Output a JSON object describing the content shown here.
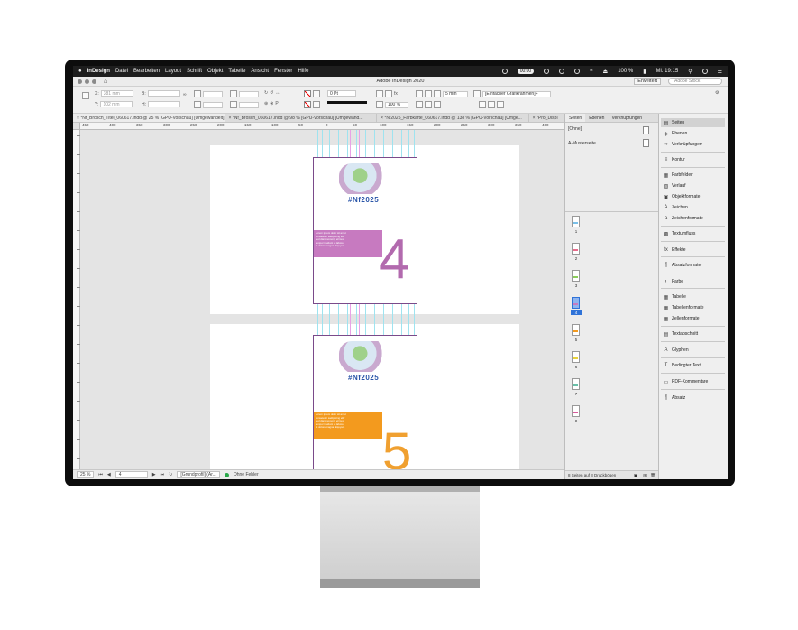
{
  "menubar": {
    "apple": "",
    "app": "InDesign",
    "items": [
      "Datei",
      "Bearbeiten",
      "Layout",
      "Schrift",
      "Objekt",
      "Tabelle",
      "Ansicht",
      "Fenster",
      "Hilfe"
    ],
    "timer": "00:00",
    "battery": "100 %",
    "clock": "Mi. 19:15"
  },
  "titlebar": {
    "title": "Adobe InDesign 2020",
    "workspace": "Erweitert",
    "search_placeholder": "Adobe Stock"
  },
  "control": {
    "x_label": "X:",
    "x_value": "381 mm",
    "y_label": "Y:",
    "y_value": "102 mm",
    "b_label": "B:",
    "h_label": "H:",
    "stroke_weight": "0 Pt",
    "opacity": "100 %",
    "gap": "5 mm",
    "frame_style": "[Einfacher Grafikrahmen]+"
  },
  "tabs": [
    "*Nf_Brosch_Titel_060617.indd @ 25 % [GPU-Vorschau] [Umgewandelt]",
    "*Nf_Brosch_060617.indd @ 98 % [GPU-Vorschau] [Umgewand...",
    "*Nf2025_Farbkarte_060617.indd @ 138 % [GPU-Vorschau] [Umge...",
    "*Pro_Displ"
  ],
  "ruler_ticks": [
    "450",
    "400",
    "350",
    "300",
    "250",
    "200",
    "150",
    "100",
    "50",
    "0",
    "50",
    "100",
    "150",
    "200",
    "250",
    "300",
    "350",
    "400"
  ],
  "pages": [
    {
      "logo": "#Nf2025",
      "number": "4",
      "band_color": "#c77ac0",
      "num_color": "#b26aae"
    },
    {
      "logo": "#Nf2025",
      "number": "5",
      "band_color": "#f39a1e",
      "num_color": "#f0a030"
    }
  ],
  "status": {
    "zoom": "25 %",
    "page_field": "4",
    "profile": "[Grundprofil] (Ar...",
    "preflight": "Ohne Fehler"
  },
  "pages_panel": {
    "tabs": [
      "Seiten",
      "Ebenen",
      "Verknüpfungen"
    ],
    "none_label": "[Ohne]",
    "master_label": "A-Musterseite",
    "thumbs": [
      {
        "n": "1",
        "c": "#7ac0e8"
      },
      {
        "n": "2",
        "c": "#e86a8a"
      },
      {
        "n": "3",
        "c": "#8acc5a"
      },
      {
        "n": "4",
        "c": "#c77ac0"
      },
      {
        "n": "5",
        "c": "#f39a1e"
      },
      {
        "n": "6",
        "c": "#e8d23a"
      },
      {
        "n": "7",
        "c": "#6ac0a8"
      },
      {
        "n": "8",
        "c": "#d85a9a"
      }
    ],
    "footer": "8 Seiten auf 8 Druckbögen"
  },
  "dock": {
    "items": [
      "Seiten",
      "Ebenen",
      "Verknüpfungen",
      "Kontur",
      "Farbfelder",
      "Verlauf",
      "Objektformate",
      "Zeichen",
      "Zeichenformate",
      "Textumfluss",
      "Effekte",
      "Absatzformate",
      "Farbe",
      "Tabelle",
      "Tabellenformate",
      "Zellenformate",
      "Textabschnitt",
      "Glyphen",
      "Bedingter Text",
      "PDF-Kommentare",
      "Absatz"
    ],
    "icons": [
      "page-icon",
      "layers-icon",
      "links-icon",
      "stroke-icon",
      "swatches-icon",
      "gradient-icon",
      "object-styles-icon",
      "character-icon",
      "character-styles-icon",
      "text-wrap-icon",
      "effects-icon",
      "paragraph-styles-icon",
      "color-icon",
      "table-icon",
      "table-styles-icon",
      "cell-styles-icon",
      "story-icon",
      "glyphs-icon",
      "conditional-text-icon",
      "pdf-comments-icon",
      "paragraph-icon"
    ]
  }
}
